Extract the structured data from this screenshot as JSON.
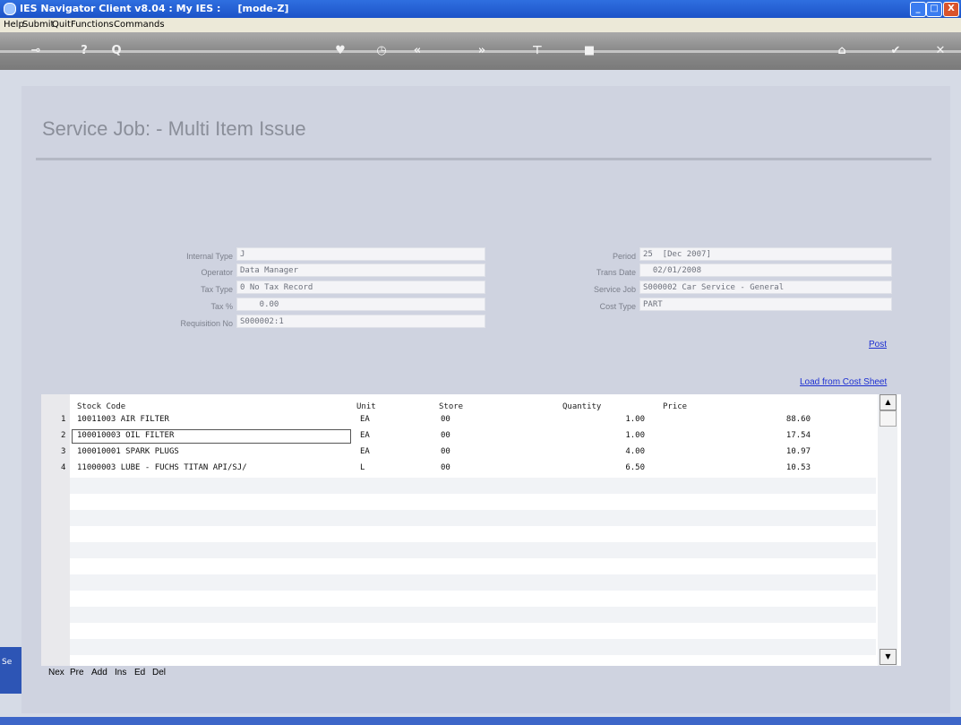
{
  "window": {
    "title": "IES Navigator Client v8.04 : My IES :     [mode-Z]",
    "min": "_",
    "max": "□",
    "close": "X"
  },
  "menu": [
    "Help",
    "Submit",
    "Quit",
    "Functions",
    "Commands"
  ],
  "page": {
    "title": "Service Job: - Multi Item Issue"
  },
  "form_left": [
    {
      "label": "Internal Type",
      "value": "J"
    },
    {
      "label": "Operator",
      "value": "Data Manager"
    },
    {
      "label": "Tax Type",
      "value": "0 No Tax Record"
    },
    {
      "label": "Tax %",
      "value": "    0.00"
    },
    {
      "label": "Requisition No",
      "value": "S000002:1"
    }
  ],
  "form_right": [
    {
      "label": "Period",
      "value": "25  [Dec 2007]"
    },
    {
      "label": "Trans Date",
      "value": "  02/01/2008"
    },
    {
      "label": "Service Job",
      "value": "S000002 Car Service - General"
    },
    {
      "label": "Cost Type",
      "value": "PART"
    }
  ],
  "links": {
    "post": "Post",
    "load": "Load from Cost Sheet"
  },
  "table": {
    "headers": [
      "Stock Code",
      "Unit",
      "Store",
      "Quantity",
      "Price"
    ],
    "rows": [
      {
        "num": "1",
        "code": "10011003 AIR FILTER",
        "unit": "EA",
        "store": "00",
        "qty": "1.00",
        "price": "88.60"
      },
      {
        "num": "2",
        "code": "100010003 OIL FILTER",
        "unit": "EA",
        "store": "00",
        "qty": "1.00",
        "price": "17.54"
      },
      {
        "num": "3",
        "code": "100010001 SPARK PLUGS",
        "unit": "EA",
        "store": "00",
        "qty": "4.00",
        "price": "10.97"
      },
      {
        "num": "4",
        "code": "11000003 LUBE - FUCHS TITAN API/SJ/",
        "unit": "L",
        "store": "00",
        "qty": "6.50",
        "price": "10.53"
      }
    ]
  },
  "bottom_buttons": [
    "Nex",
    "Pre",
    "Add",
    "Ins",
    "Ed",
    "Del"
  ],
  "side_stub": "Se",
  "icons": [
    "key-icon",
    "help-icon",
    "search-icon",
    "heart-icon",
    "clock-icon",
    "first-icon",
    "last-icon",
    "tree-icon",
    "stop-icon",
    "home-icon",
    "check-icon",
    "close-icon"
  ]
}
